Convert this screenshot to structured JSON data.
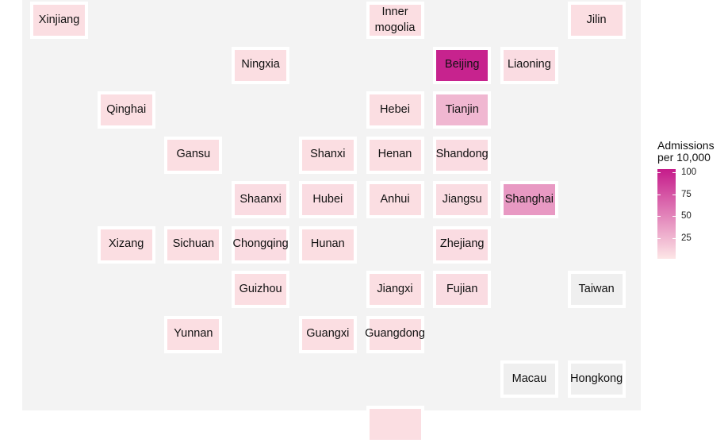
{
  "chart_data": {
    "type": "heatmap",
    "subtype": "tile-grid map",
    "grid": {
      "cols": 9,
      "row_pitch": 56.5,
      "col_pitch": 84.7
    },
    "tiles": [
      {
        "name": "Xinjiang",
        "row": 0,
        "col": 0,
        "value": 5
      },
      {
        "name": "Inner\nmogolia",
        "row": 0,
        "col": 5,
        "value": 5
      },
      {
        "name": "Jilin",
        "row": 0,
        "col": 8,
        "value": 5
      },
      {
        "name": "Ningxia",
        "row": 1,
        "col": 3,
        "value": 5
      },
      {
        "name": "Beijing",
        "row": 1,
        "col": 6,
        "value": 100
      },
      {
        "name": "Liaoning",
        "row": 1,
        "col": 7,
        "value": 6
      },
      {
        "name": "Qinghai",
        "row": 2,
        "col": 1,
        "value": 5
      },
      {
        "name": "Hebei",
        "row": 2,
        "col": 5,
        "value": 5
      },
      {
        "name": "Tianjin",
        "row": 2,
        "col": 6,
        "value": 25
      },
      {
        "name": "Gansu",
        "row": 3,
        "col": 2,
        "value": 5
      },
      {
        "name": "Shanxi",
        "row": 3,
        "col": 4,
        "value": 5
      },
      {
        "name": "Henan",
        "row": 3,
        "col": 5,
        "value": 5
      },
      {
        "name": "Shandong",
        "row": 3,
        "col": 6,
        "value": 6
      },
      {
        "name": "Shaanxi",
        "row": 4,
        "col": 3,
        "value": 6
      },
      {
        "name": "Hubei",
        "row": 4,
        "col": 4,
        "value": 6
      },
      {
        "name": "Anhui",
        "row": 4,
        "col": 5,
        "value": 5
      },
      {
        "name": "Jiangsu",
        "row": 4,
        "col": 6,
        "value": 6
      },
      {
        "name": "Shanghai",
        "row": 4,
        "col": 7,
        "value": 40
      },
      {
        "name": "Xizang",
        "row": 5,
        "col": 1,
        "value": 5
      },
      {
        "name": "Sichuan",
        "row": 5,
        "col": 2,
        "value": 5
      },
      {
        "name": "Chongqing",
        "row": 5,
        "col": 3,
        "value": 6
      },
      {
        "name": "Hunan",
        "row": 5,
        "col": 4,
        "value": 5
      },
      {
        "name": "Zhejiang",
        "row": 5,
        "col": 6,
        "value": 6
      },
      {
        "name": "Guizhou",
        "row": 6,
        "col": 3,
        "value": 5
      },
      {
        "name": "Jiangxi",
        "row": 6,
        "col": 5,
        "value": 5
      },
      {
        "name": "Fujian",
        "row": 6,
        "col": 6,
        "value": 6
      },
      {
        "name": "Taiwan",
        "row": 6,
        "col": 8,
        "value": null
      },
      {
        "name": "Yunnan",
        "row": 7,
        "col": 2,
        "value": 5
      },
      {
        "name": "Guangxi",
        "row": 7,
        "col": 4,
        "value": 5
      },
      {
        "name": "Guangdong",
        "row": 7,
        "col": 5,
        "value": 5
      },
      {
        "name": "Macau",
        "row": 8,
        "col": 7,
        "value": null
      },
      {
        "name": "Hongkong",
        "row": 8,
        "col": 8,
        "value": null
      },
      {
        "name": "",
        "row": 9,
        "col": 5,
        "value": 5
      }
    ],
    "legend": {
      "title": "Admissions\nper 10,000",
      "ticks": [
        25,
        50,
        75,
        100
      ],
      "range": [
        1,
        104
      ],
      "low_color": "#fde6e6",
      "high_color": "#c51b8a"
    },
    "missing_color": "#efefef"
  }
}
